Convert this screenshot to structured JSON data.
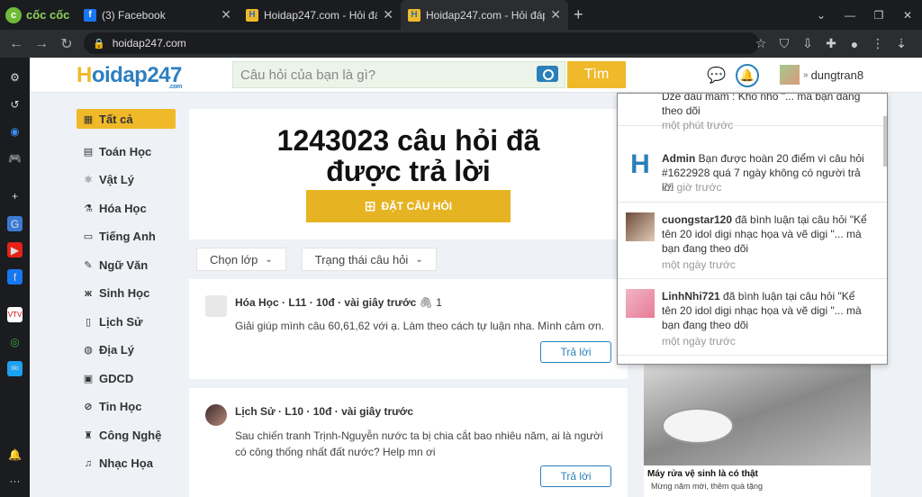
{
  "browser": {
    "brand": "cốc cốc",
    "tabs": [
      {
        "title": "(3) Facebook",
        "favicon": "f"
      },
      {
        "title": "Hoidap247.com - Hỏi đáp bài",
        "favicon": "H"
      },
      {
        "title": "Hoidap247.com - Hỏi đáp bài",
        "favicon": "H"
      }
    ],
    "url": "hoidap247.com"
  },
  "site": {
    "logo_h": "H",
    "logo_rest": "oidap247",
    "logo_com": ".com",
    "search_placeholder": "Câu hỏi của bạn là gì?",
    "search_button": "Tìm",
    "username": "dungtran8"
  },
  "categories": [
    {
      "label": "Tất cả",
      "icon": "▦"
    },
    {
      "label": "Toán Học",
      "icon": "▤"
    },
    {
      "label": "Vật Lý",
      "icon": "⚛"
    },
    {
      "label": "Hóa Học",
      "icon": "⚗"
    },
    {
      "label": "Tiếng Anh",
      "icon": "▭"
    },
    {
      "label": "Ngữ Văn",
      "icon": "✎"
    },
    {
      "label": "Sinh Học",
      "icon": "ж"
    },
    {
      "label": "Lịch Sử",
      "icon": "▯"
    },
    {
      "label": "Địa Lý",
      "icon": "◍"
    },
    {
      "label": "GDCD",
      "icon": "▣"
    },
    {
      "label": "Tin Học",
      "icon": "⊘"
    },
    {
      "label": "Công Nghệ",
      "icon": "♜"
    },
    {
      "label": "Nhạc Họa",
      "icon": "♫"
    }
  ],
  "hero": {
    "line1": "1243023 câu hỏi đã",
    "line2": "được trả lời",
    "ask_button": "ĐẶT CÂU HỎI"
  },
  "filters": {
    "grade": "Chọn lớp",
    "status": "Trạng thái câu hỏi"
  },
  "questions": [
    {
      "subject": "Hóa Học",
      "grade": "L11",
      "points": "10đ",
      "time": "vài giây trước",
      "attach": "1",
      "text": "Giải giúp mình câu 60,61,62 với ạ. Làm theo cách tự luận nha. Mình cảm ơn.",
      "reply": "Trả lời"
    },
    {
      "subject": "Lịch Sử",
      "grade": "L10",
      "points": "10đ",
      "time": "vài giây trước",
      "text": "Sau chiến tranh Trịnh-Nguyễn nước ta bị chia cắt bao nhiêu năm, ai là người có công thống nhất đất nước? Help mn ơi",
      "reply": "Trả lời"
    }
  ],
  "notifications": [
    {
      "user": "",
      "text": "Dze đầu mâm : Khò nhò \"... mà bạn đang theo dõi",
      "time": "một phút trước"
    },
    {
      "user": "Admin",
      "text": " Bạn được hoàn  20 điểm vì câu hỏi #1622928 quá 7 ngày không có người trả lời",
      "time": "20 giờ trước"
    },
    {
      "user": "cuongstar120",
      "text": " đã bình luận tại câu hỏi \"Kể tên 20 idol digi nhạc họa và vẽ digi  \"... mà bạn đang theo dõi",
      "time": "một ngày trước"
    },
    {
      "user": "LinhNhi721",
      "text": " đã bình luận tại câu hỏi \"Kể tên 20 idol digi nhạc họa và vẽ digi  \"... mà bạn đang theo dõi",
      "time": "một ngày trước"
    }
  ],
  "ad": {
    "title": "Máy rửa vệ sinh là có thật",
    "subtitle": "Mừng năm mới, thêm quà tặng"
  }
}
